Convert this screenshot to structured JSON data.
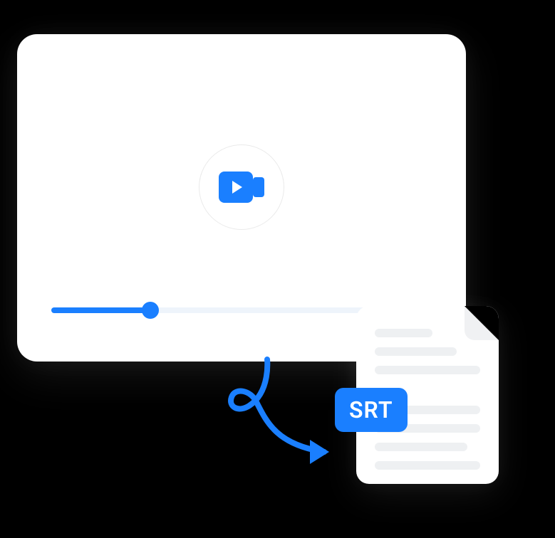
{
  "colors": {
    "primary": "#1a7fff",
    "background": "#000000",
    "card": "#ffffff",
    "line": "#eef0f2",
    "track": "#eef4fb"
  },
  "video": {
    "progress_percent": 26
  },
  "file": {
    "badge_label": "SRT"
  },
  "icons": {
    "camera": "video-camera-icon",
    "arrow": "curved-arrow-icon"
  }
}
